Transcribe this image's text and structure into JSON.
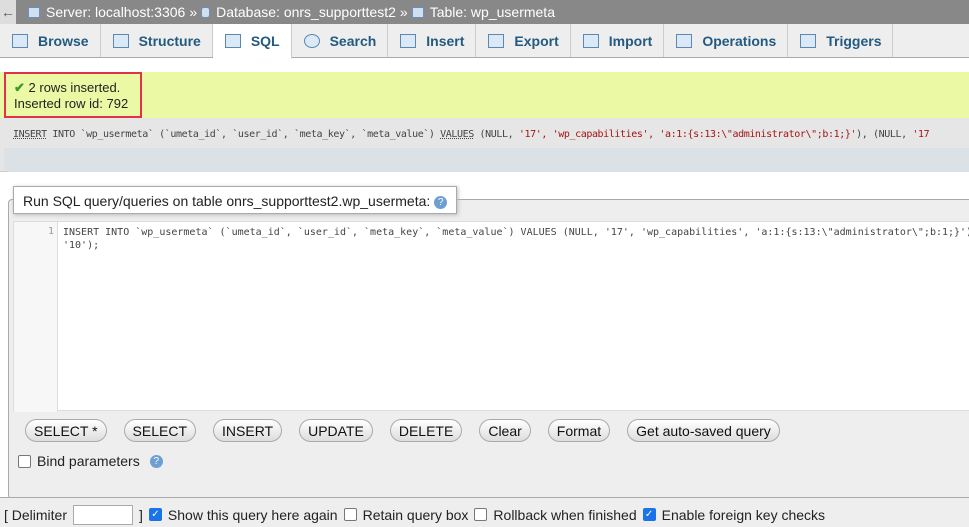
{
  "breadcrumb": {
    "back": "←",
    "server": "Server: localhost:3306",
    "database": "Database: onrs_supporttest2",
    "table": "Table: wp_usermeta",
    "sep": "»"
  },
  "tabs": [
    {
      "label": "Browse",
      "icon": "browse-icon"
    },
    {
      "label": "Structure",
      "icon": "structure-icon"
    },
    {
      "label": "SQL",
      "icon": "sql-icon",
      "active": true
    },
    {
      "label": "Search",
      "icon": "search-icon"
    },
    {
      "label": "Insert",
      "icon": "insert-icon"
    },
    {
      "label": "Export",
      "icon": "export-icon"
    },
    {
      "label": "Import",
      "icon": "import-icon"
    },
    {
      "label": "Operations",
      "icon": "operations-icon"
    },
    {
      "label": "Triggers",
      "icon": "triggers-icon"
    }
  ],
  "message": {
    "line1": "2 rows inserted.",
    "line2": "Inserted row id: 792"
  },
  "executed_sql": {
    "a": "INSERT",
    "b": " INTO `wp_usermeta` (`umeta_id`, `user_id`, `meta_key`, `meta_value`) ",
    "c": "VALUES",
    "d": " (NULL, ",
    "e": "'17', 'wp_capabilities', 'a:1:{s:13:\\\"administrator\\\";b:1;}'",
    "f": "), (NULL, ",
    "g": "'17"
  },
  "query_box": {
    "title": "Run SQL query/queries on table ",
    "table": "onrs_supporttest2.wp_usermeta:",
    "help": "?",
    "line_number": "1",
    "code_line1": "INSERT INTO `wp_usermeta` (`umeta_id`, `user_id`, `meta_key`, `meta_value`) VALUES (NULL, '17', 'wp_capabilities', 'a:1:{s:13:\\\"administrator\\\";b:1;}'), (N",
    "code_line2": "'10');"
  },
  "buttons": [
    "SELECT *",
    "SELECT",
    "INSERT",
    "UPDATE",
    "DELETE",
    "Clear",
    "Format",
    "Get auto-saved query"
  ],
  "bind_parameters": {
    "label": "Bind parameters",
    "checked": false
  },
  "options": {
    "delimiter_label": "[ Delimiter",
    "delimiter_close": "]",
    "show_query": "Show this query here again",
    "show_query_checked": true,
    "retain": "Retain query box",
    "retain_checked": false,
    "rollback": "Rollback when finished",
    "rollback_checked": false,
    "fk": "Enable foreign key checks",
    "fk_checked": true
  }
}
